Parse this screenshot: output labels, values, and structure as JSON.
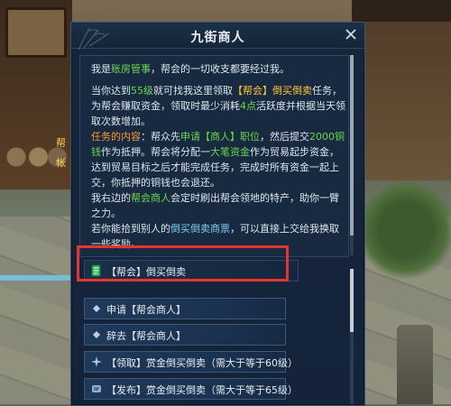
{
  "window": {
    "title": "九街商人",
    "close_label": "✕"
  },
  "scene": {
    "npc_line1": "帮",
    "npc_line2": "帐"
  },
  "dialog": {
    "p1": [
      {
        "t": "我是"
      },
      {
        "t": "账房管事",
        "c": "hl-green"
      },
      {
        "t": "，帮会的一切收支都要经过我。"
      }
    ],
    "p2": [
      {
        "t": "当你达到"
      },
      {
        "t": "55级",
        "c": "hl-green"
      },
      {
        "t": "就可找我这里领取"
      },
      {
        "t": "【帮会】倒买倒卖",
        "c": "hl-yellow"
      },
      {
        "t": "任务，为帮会赚取资金，领取时最少消耗"
      },
      {
        "t": "4点",
        "c": "hl-green"
      },
      {
        "t": "活跃度并根据当天领取次数增加。"
      }
    ],
    "p3": [
      {
        "t": "任务的内容",
        "c": "hl-orange"
      },
      {
        "t": "：帮众先"
      },
      {
        "t": "申请【商人】职位",
        "c": "hl-green"
      },
      {
        "t": "，然后提交"
      },
      {
        "t": "2000铜钱",
        "c": "hl-green"
      },
      {
        "t": "作为抵押。帮会将分配一"
      },
      {
        "t": "大笔资金",
        "c": "hl-green"
      },
      {
        "t": "作为贸易起步资金，达到贸易目标之后才能完成任务，完成时所有资金一起上交，你抵押的铜钱也会退还。"
      }
    ],
    "p4": [
      {
        "t": "我右边的"
      },
      {
        "t": "帮会商人",
        "c": "hl-green"
      },
      {
        "t": "会定时刷出帮会领地的特产，助你一臂之力。"
      }
    ],
    "p5": [
      {
        "t": "若你能拾到别人的"
      },
      {
        "t": "倒买倒卖商票",
        "c": "hl-cyan"
      },
      {
        "t": "，可以直接上交给我换取一些奖励。"
      }
    ]
  },
  "options": [
    {
      "label": "【帮会】倒买倒卖",
      "icon": "quest-scroll-icon"
    },
    {
      "label": "申请【帮会商人】",
      "icon": "diamond-bullet-icon"
    },
    {
      "label": "辞去【帮会商人】",
      "icon": "diamond-bullet-icon"
    },
    {
      "label": "【领取】赏金倒买倒卖（需大于等于60级）",
      "icon": "sparkle-icon"
    },
    {
      "label": "【发布】赏金倒买倒卖（需大于等于65级）",
      "icon": "scroll-icon"
    }
  ],
  "colors": {
    "panel_bg": "#14233a",
    "highlight_green": "#6bd84b",
    "highlight_yellow": "#ffc63a",
    "highlight_orange": "#ff9a2a",
    "annotation_red": "#e8332e"
  }
}
